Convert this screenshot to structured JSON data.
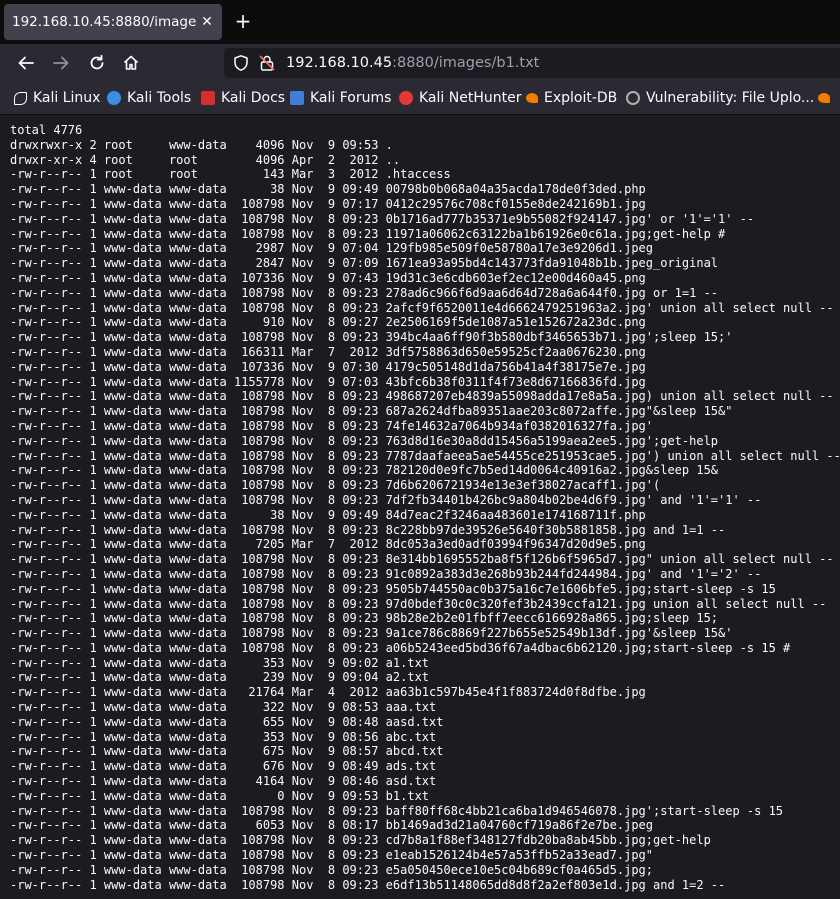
{
  "tab": {
    "title": "192.168.10.45:8880/images/b1.txt",
    "close_glyph": "✕",
    "new_tab_glyph": "+"
  },
  "nav": {
    "url_host": "192.168.10.45",
    "url_rest": ":8880/images/b1.txt"
  },
  "bookmarks": [
    {
      "label": "Kali Linux",
      "icon": "kali-dragon-icon",
      "color": "#ffffff"
    },
    {
      "label": "Kali Tools",
      "icon": "kali-tools-icon",
      "color": "#3a8ee6"
    },
    {
      "label": "Kali Docs",
      "icon": "kali-docs-icon",
      "color": "#d32f2f"
    },
    {
      "label": "Kali Forums",
      "icon": "kali-forums-icon",
      "color": "#3f7fd6"
    },
    {
      "label": "Kali NetHunter",
      "icon": "nethunter-icon",
      "color": "#e53935"
    },
    {
      "label": "Exploit-DB",
      "icon": "exploit-db-icon",
      "color": "#f57c00"
    },
    {
      "label": "Vulnerability: File Uplo...",
      "icon": "dvwa-icon",
      "color": "#b0b0b0"
    },
    {
      "label": "",
      "icon": "exploit-db-icon",
      "color": "#f57c00"
    }
  ],
  "listing": [
    "total 4776",
    "drwxrwxr-x 2 root     www-data    4096 Nov  9 09:53 .",
    "drwxr-xr-x 4 root     root        4096 Apr  2  2012 ..",
    "-rw-r--r-- 1 root     root         143 Mar  3  2012 .htaccess",
    "-rw-r--r-- 1 www-data www-data      38 Nov  9 09:49 00798b0b068a04a35acda178de0f3ded.php",
    "-rw-r--r-- 1 www-data www-data  108798 Nov  9 07:17 0412c29576c708cf0155e8de242169b1.jpg",
    "-rw-r--r-- 1 www-data www-data  108798 Nov  8 09:23 0b1716ad777b35371e9b55082f924147.jpg' or '1'='1' --",
    "-rw-r--r-- 1 www-data www-data  108798 Nov  8 09:23 11971a06062c63122ba1b61926e0c61a.jpg;get-help #",
    "-rw-r--r-- 1 www-data www-data    2987 Nov  9 07:04 129fb985e509f0e58780a17e3e9206d1.jpeg",
    "-rw-r--r-- 1 www-data www-data    2847 Nov  9 07:09 1671ea93a95bd4c143773fda91048b1b.jpeg_original",
    "-rw-r--r-- 1 www-data www-data  107336 Nov  9 07:43 19d31c3e6cdb603ef2ec12e00d460a45.png",
    "-rw-r--r-- 1 www-data www-data  108798 Nov  8 09:23 278ad6c966f6d9aa6d64d728a6a644f0.jpg or 1=1 --",
    "-rw-r--r-- 1 www-data www-data  108798 Nov  8 09:23 2afcf9f6520011e4d6662479251963a2.jpg' union all select null --",
    "-rw-r--r-- 1 www-data www-data     910 Nov  8 09:27 2e2506169f5de1087a51e152672a23dc.png",
    "-rw-r--r-- 1 www-data www-data  108798 Nov  8 09:23 394bc4aa6ff90f3b580dbf3465653b71.jpg';sleep 15;'",
    "-rw-r--r-- 1 www-data www-data  166311 Mar  7  2012 3df5758863d650e59525cf2aa0676230.png",
    "-rw-r--r-- 1 www-data www-data  107336 Nov  9 07:30 4179c505148d1da756b41a4f38175e7e.jpg",
    "-rw-r--r-- 1 www-data www-data 1155778 Nov  9 07:03 43bfc6b38f0311f4f73e8d67166836fd.jpg",
    "-rw-r--r-- 1 www-data www-data  108798 Nov  8 09:23 498687207eb4839a55098adda17e8a5a.jpg) union all select null --",
    "-rw-r--r-- 1 www-data www-data  108798 Nov  8 09:23 687a2624dfba89351aae203c8072affe.jpg\"&sleep 15&\"",
    "-rw-r--r-- 1 www-data www-data  108798 Nov  8 09:23 74fe14632a7064b934af0382016327fa.jpg'",
    "-rw-r--r-- 1 www-data www-data  108798 Nov  8 09:23 763d8d16e30a8dd15456a5199aea2ee5.jpg';get-help",
    "-rw-r--r-- 1 www-data www-data  108798 Nov  8 09:23 7787daafaeea5ae54455ce251953cae5.jpg') union all select null --",
    "-rw-r--r-- 1 www-data www-data  108798 Nov  8 09:23 782120d0e9fc7b5ed14d0064c40916a2.jpg&sleep 15&",
    "-rw-r--r-- 1 www-data www-data  108798 Nov  8 09:23 7d6b6206721934e13e3ef38027acaff1.jpg'(",
    "-rw-r--r-- 1 www-data www-data  108798 Nov  8 09:23 7df2fb34401b426bc9a804b02be4d6f9.jpg' and '1'='1' --",
    "-rw-r--r-- 1 www-data www-data      38 Nov  9 09:49 84d7eac2f3246aa483601e174168711f.php",
    "-rw-r--r-- 1 www-data www-data  108798 Nov  8 09:23 8c228bb97de39526e5640f30b5881858.jpg and 1=1 --",
    "-rw-r--r-- 1 www-data www-data    7205 Mar  7  2012 8dc053a3ed0adf03994f96347d20d9e5.png",
    "-rw-r--r-- 1 www-data www-data  108798 Nov  8 09:23 8e314bb1695552ba8f5f126b6f5965d7.jpg\" union all select null --",
    "-rw-r--r-- 1 www-data www-data  108798 Nov  8 09:23 91c0892a383d3e268b93b244fd244984.jpg' and '1'='2' --",
    "-rw-r--r-- 1 www-data www-data  108798 Nov  8 09:23 9505b744550ac0b375a16c7e1606bfe5.jpg;start-sleep -s 15",
    "-rw-r--r-- 1 www-data www-data  108798 Nov  8 09:23 97d0bdef30c0c320fef3b2439ccfa121.jpg union all select null --",
    "-rw-r--r-- 1 www-data www-data  108798 Nov  8 09:23 98b28e2b2e01fbff7eecc6166928a865.jpg;sleep 15;",
    "-rw-r--r-- 1 www-data www-data  108798 Nov  8 09:23 9a1ce786c8869f227b655e52549b13df.jpg'&sleep 15&'",
    "-rw-r--r-- 1 www-data www-data  108798 Nov  8 09:23 a06b5243eed5bd36f67a4dbac6b62120.jpg;start-sleep -s 15 #",
    "-rw-r--r-- 1 www-data www-data     353 Nov  9 09:02 a1.txt",
    "-rw-r--r-- 1 www-data www-data     239 Nov  9 09:04 a2.txt",
    "-rw-r--r-- 1 www-data www-data   21764 Mar  4  2012 aa63b1c597b45e4f1f883724d0f8dfbe.jpg",
    "-rw-r--r-- 1 www-data www-data     322 Nov  9 08:53 aaa.txt",
    "-rw-r--r-- 1 www-data www-data     655 Nov  9 08:48 aasd.txt",
    "-rw-r--r-- 1 www-data www-data     353 Nov  9 08:56 abc.txt",
    "-rw-r--r-- 1 www-data www-data     675 Nov  9 08:57 abcd.txt",
    "-rw-r--r-- 1 www-data www-data     676 Nov  9 08:49 ads.txt",
    "-rw-r--r-- 1 www-data www-data    4164 Nov  9 08:46 asd.txt",
    "-rw-r--r-- 1 www-data www-data       0 Nov  9 09:53 b1.txt",
    "-rw-r--r-- 1 www-data www-data  108798 Nov  8 09:23 baff80ff68c4bb21ca6ba1d946546078.jpg';start-sleep -s 15",
    "-rw-r--r-- 1 www-data www-data    6053 Nov  8 08:17 bb1469ad3d21a04760cf719a86f2e7be.jpeg",
    "-rw-r--r-- 1 www-data www-data  108798 Nov  8 09:23 cd7b8a1f88ef348127fdb20ba8ab45bb.jpg;get-help",
    "-rw-r--r-- 1 www-data www-data  108798 Nov  8 09:23 e1eab1526124b4e57a53ffb52a33ead7.jpg\"",
    "-rw-r--r-- 1 www-data www-data  108798 Nov  8 09:23 e5a050450ece10e5c04b689cf0a465d5.jpg;",
    "-rw-r--r-- 1 www-data www-data  108798 Nov  8 09:23 e6df13b51148065dd8d8f2a2ef803e1d.jpg and 1=2 --"
  ]
}
